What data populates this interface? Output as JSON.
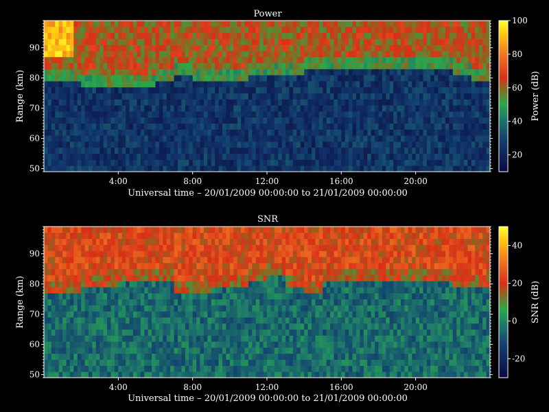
{
  "chart_data": [
    {
      "type": "heatmap",
      "title": "Power",
      "xlabel": "Universal time – 20/01/2009 00:00:00 to 21/01/2009 00:00:00",
      "ylabel": "Range (km)",
      "xlim": [
        0,
        24
      ],
      "ylim": [
        49,
        99
      ],
      "x_ticks": [
        "4:00",
        "8:00",
        "12:00",
        "16:00",
        "20:00"
      ],
      "y_ticks": [
        50,
        60,
        70,
        80,
        90
      ],
      "colorbar": {
        "label": "Power (dB)",
        "ticks": [
          20,
          40,
          60,
          80,
          100
        ],
        "range": [
          10,
          100
        ]
      },
      "z_summary": {
        "low_range_background": 25,
        "upper_layer_base_km_by_hour": [
          81,
          81,
          80,
          80,
          79,
          80,
          82,
          83,
          82,
          82,
          81,
          83,
          84,
          83,
          85,
          86,
          86,
          86,
          86,
          86,
          86,
          85,
          83,
          81
        ],
        "upper_layer_level": 62,
        "enhanced_corner": {
          "hours": [
            0,
            1.5
          ],
          "range_km": [
            88,
            99
          ],
          "level": 90
        }
      }
    },
    {
      "type": "heatmap",
      "title": "SNR",
      "xlabel": "Universal time – 20/01/2009 00:00:00 to 21/01/2009 00:00:00",
      "ylabel": "Range (km)",
      "xlim": [
        0,
        24
      ],
      "ylim": [
        49,
        99
      ],
      "x_ticks": [
        "4:00",
        "8:00",
        "12:00",
        "16:00",
        "20:00"
      ],
      "y_ticks": [
        50,
        60,
        70,
        80,
        90
      ],
      "colorbar": {
        "label": "SNR (dB)",
        "ticks": [
          -20,
          0,
          20,
          40
        ],
        "range": [
          -30,
          50
        ]
      },
      "z_summary": {
        "low_range_background": -5,
        "upper_layer_base_km_by_hour": [
          80,
          80,
          81,
          82,
          84,
          84,
          83,
          80,
          79,
          81,
          82,
          84,
          85,
          82,
          80,
          83,
          84,
          83,
          83,
          84,
          84,
          83,
          82,
          81
        ],
        "upper_layer_level": 22
      }
    }
  ]
}
